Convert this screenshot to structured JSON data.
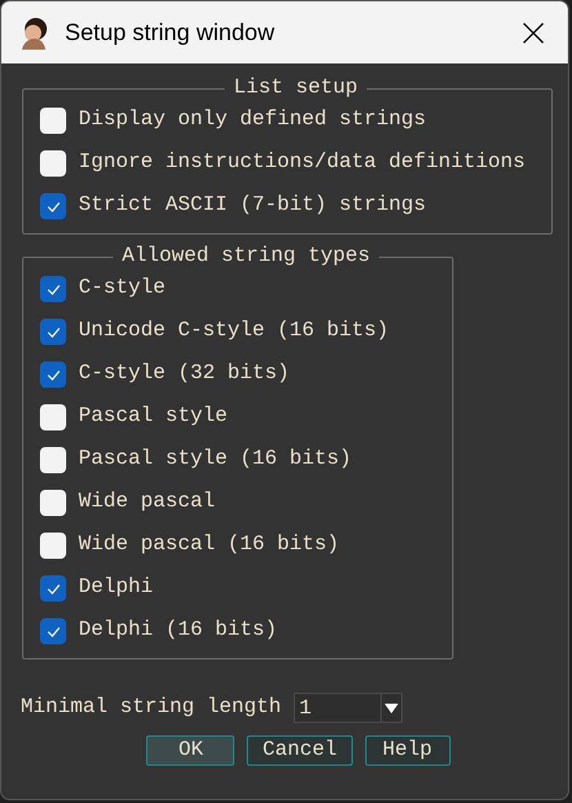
{
  "window": {
    "title": "Setup string window"
  },
  "list_setup": {
    "title": "List setup",
    "options": [
      {
        "label": "Display only defined strings",
        "checked": false
      },
      {
        "label": "Ignore instructions/data definitions",
        "checked": false
      },
      {
        "label": "Strict ASCII (7-bit) strings",
        "checked": true
      }
    ]
  },
  "string_types": {
    "title": "Allowed string types",
    "options": [
      {
        "label": "C-style",
        "checked": true
      },
      {
        "label": "Unicode C-style (16 bits)",
        "checked": true
      },
      {
        "label": "C-style (32 bits)",
        "checked": true
      },
      {
        "label": "Pascal style",
        "checked": false
      },
      {
        "label": "Pascal style (16 bits)",
        "checked": false
      },
      {
        "label": "Wide pascal",
        "checked": false
      },
      {
        "label": "Wide pascal (16 bits)",
        "checked": false
      },
      {
        "label": "Delphi",
        "checked": true
      },
      {
        "label": "Delphi (16 bits)",
        "checked": true
      }
    ]
  },
  "min_length": {
    "label": "Minimal string length",
    "value": "1"
  },
  "buttons": [
    {
      "label": "OK",
      "selected": true
    },
    {
      "label": "Cancel",
      "selected": false
    },
    {
      "label": "Help",
      "selected": false
    }
  ]
}
